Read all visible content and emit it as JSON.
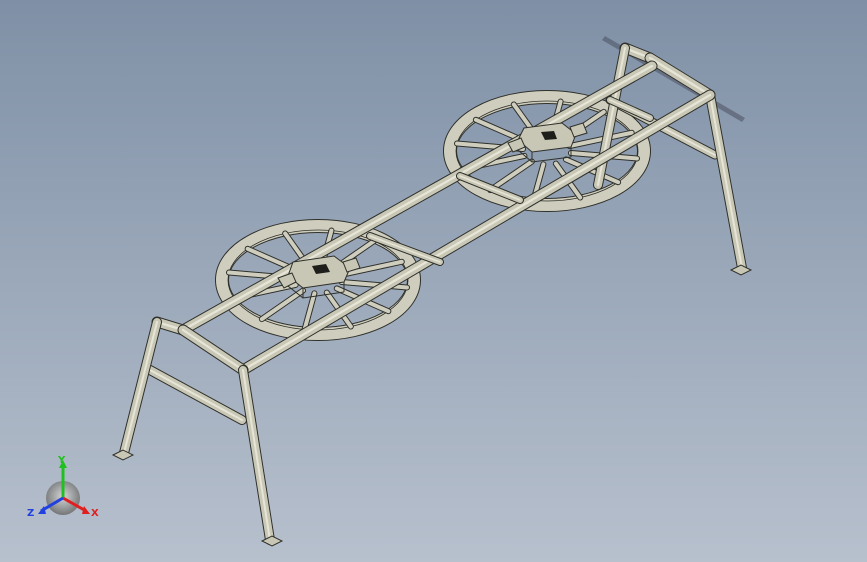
{
  "window": {
    "title": ""
  },
  "model": {
    "type": "3d-frame-assembly",
    "view": "isometric",
    "colors": {
      "background_top": "#7f90a6",
      "background_bottom": "#b7c0cd",
      "part_fill": "#c9c8b7",
      "part_edge": "#2f302a"
    }
  },
  "triad": {
    "x_label": "X",
    "y_label": "Y",
    "z_label": "Z",
    "x_color": "#e02020",
    "y_color": "#20c020",
    "z_color": "#2040e0"
  }
}
